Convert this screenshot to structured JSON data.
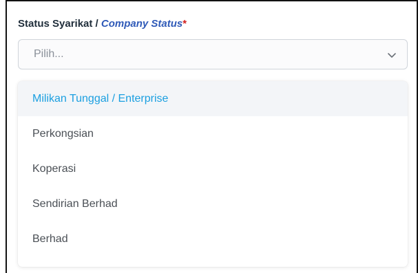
{
  "field": {
    "label_ms": "Status Syarikat",
    "label_sep": " / ",
    "label_en": "Company Status",
    "required_mark": "*"
  },
  "select": {
    "placeholder": "Pilih...",
    "icon": "chevron-down-icon"
  },
  "options": [
    {
      "label": "Milikan Tunggal / Enterprise",
      "highlighted": true
    },
    {
      "label": "Perkongsian",
      "highlighted": false
    },
    {
      "label": "Koperasi",
      "highlighted": false
    },
    {
      "label": "Sendirian Berhad",
      "highlighted": false
    },
    {
      "label": "Berhad",
      "highlighted": false
    }
  ],
  "colors": {
    "label_en": "#2f5ab8",
    "required": "#d11f1f",
    "highlight_text": "#1a9fe0",
    "highlight_bg": "#f3f5f8"
  }
}
